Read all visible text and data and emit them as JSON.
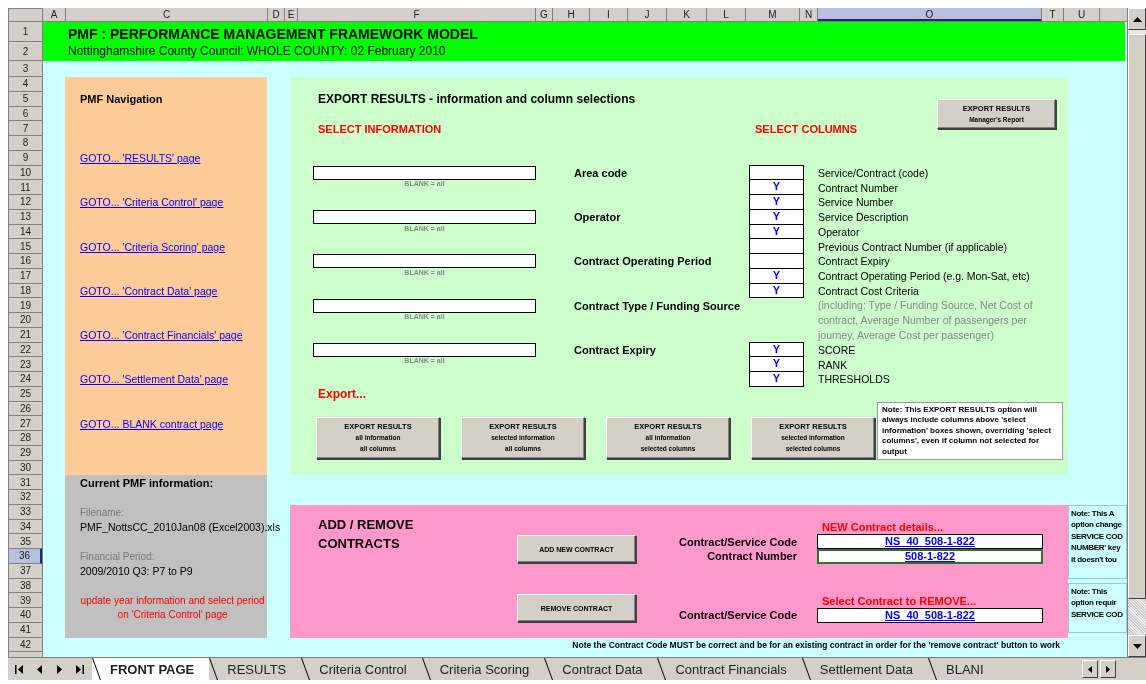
{
  "sheet": {
    "column_headers": [
      {
        "label": "A",
        "selected": false
      },
      {
        "label": "C",
        "selected": false
      },
      {
        "label": "D",
        "selected": false
      },
      {
        "label": "E",
        "selected": false
      },
      {
        "label": "F",
        "selected": false
      },
      {
        "label": "G",
        "selected": false
      },
      {
        "label": "H",
        "selected": false
      },
      {
        "label": "I",
        "selected": false
      },
      {
        "label": "J",
        "selected": false
      },
      {
        "label": "K",
        "selected": false
      },
      {
        "label": "L",
        "selected": false
      },
      {
        "label": "M",
        "selected": false
      },
      {
        "label": "N",
        "selected": false
      },
      {
        "label": "O",
        "selected": true
      },
      {
        "label": "T",
        "selected": false
      },
      {
        "label": "U",
        "selected": false
      }
    ],
    "row_headers": [
      {
        "label": "1",
        "selected": false
      },
      {
        "label": "2",
        "selected": false
      },
      {
        "label": "3",
        "selected": false
      },
      {
        "label": "4",
        "selected": false
      },
      {
        "label": "5",
        "selected": false
      },
      {
        "label": "6",
        "selected": false
      },
      {
        "label": "7",
        "selected": false
      },
      {
        "label": "8",
        "selected": false
      },
      {
        "label": "9",
        "selected": false
      },
      {
        "label": "10",
        "selected": false
      },
      {
        "label": "11",
        "selected": false
      },
      {
        "label": "12",
        "selected": false
      },
      {
        "label": "13",
        "selected": false
      },
      {
        "label": "14",
        "selected": false
      },
      {
        "label": "15",
        "selected": false
      },
      {
        "label": "16",
        "selected": false
      },
      {
        "label": "17",
        "selected": false
      },
      {
        "label": "18",
        "selected": false
      },
      {
        "label": "19",
        "selected": false
      },
      {
        "label": "20",
        "selected": false
      },
      {
        "label": "21",
        "selected": false
      },
      {
        "label": "22",
        "selected": false
      },
      {
        "label": "23",
        "selected": false
      },
      {
        "label": "24",
        "selected": false
      },
      {
        "label": "25",
        "selected": false
      },
      {
        "label": "26",
        "selected": false
      },
      {
        "label": "27",
        "selected": false
      },
      {
        "label": "28",
        "selected": false
      },
      {
        "label": "29",
        "selected": false
      },
      {
        "label": "30",
        "selected": false
      },
      {
        "label": "31",
        "selected": false
      },
      {
        "label": "32",
        "selected": false
      },
      {
        "label": "33",
        "selected": false
      },
      {
        "label": "34",
        "selected": false
      },
      {
        "label": "35",
        "selected": false
      },
      {
        "label": "36",
        "selected": true
      },
      {
        "label": "37",
        "selected": false
      },
      {
        "label": "38",
        "selected": false
      },
      {
        "label": "39",
        "selected": false
      },
      {
        "label": "40",
        "selected": false
      },
      {
        "label": "41",
        "selected": false
      },
      {
        "label": "42",
        "selected": false
      }
    ]
  },
  "banner": {
    "title": "PMF : PERFORMANCE MANAGEMENT FRAMEWORK MODEL",
    "subtitle": "Nottinghamshire County Council: WHOLE COUNTY: 02 February 2010"
  },
  "navigation": {
    "title": "PMF Navigation",
    "links": [
      "GOTO... 'RESULTS' page",
      "GOTO... 'Criteria Control' page",
      "GOTO... 'Criteria Scoring' page",
      "GOTO... 'Contract Data' page",
      "GOTO... 'Contract Financials' page",
      "GOTO... 'Settlement Data' page",
      "GOTO... BLANK contract page"
    ]
  },
  "export_results": {
    "title": "EXPORT RESULTS - information and column selections",
    "manager_button": [
      "EXPORT RESULTS",
      "Manager's Report"
    ],
    "select_information_heading": "SELECT INFORMATION",
    "select_columns_heading": "SELECT COLUMNS",
    "filters": [
      {
        "label": "Area code",
        "hint": "BLANK = all"
      },
      {
        "label": "Operator",
        "hint": "BLANK = all"
      },
      {
        "label": "Contract Operating Period",
        "hint": "BLANK = all"
      },
      {
        "label": "Contract Type / Funding Source",
        "hint": "BLANK = all"
      },
      {
        "label": "Contract Expiry",
        "hint": "BLANK = all"
      }
    ],
    "columns": [
      {
        "kind": "column",
        "label": "Service/Contract (code)"
      },
      {
        "kind": "column",
        "label": "Contract Number",
        "value": "Y"
      },
      {
        "kind": "column",
        "label": "Service Number",
        "value": "Y"
      },
      {
        "kind": "column",
        "label": "Service Description",
        "value": "Y"
      },
      {
        "kind": "column",
        "label": "Operator",
        "value": "Y"
      },
      {
        "kind": "column",
        "label": "Previous Contract Number (if applicable)"
      },
      {
        "kind": "column",
        "label": "Contract Expiry"
      },
      {
        "kind": "column",
        "label": "Contract Operating Period (e.g. Mon-Sat, etc)",
        "value": "Y"
      },
      {
        "kind": "column",
        "label": "Contract Cost Criteria",
        "value": "Y"
      },
      {
        "kind": "note",
        "label": "(including: Type / Funding Source, Net Cost of contract, Average Number of passengers per journey, Average Cost per passenger)"
      },
      {
        "kind": "column",
        "label": "SCORE",
        "value": "Y"
      },
      {
        "kind": "column",
        "label": "RANK",
        "value": "Y"
      },
      {
        "kind": "column",
        "label": "THRESHOLDS",
        "value": "Y"
      }
    ],
    "export_heading": "Export...",
    "buttons": [
      [
        "EXPORT RESULTS",
        "all information",
        "all columns"
      ],
      [
        "EXPORT RESULTS",
        "selected information",
        "all columns"
      ],
      [
        "EXPORT RESULTS",
        "all information",
        "selected columns"
      ],
      [
        "EXPORT RESULTS",
        "selected information",
        "selected columns"
      ]
    ],
    "note": "Note: This EXPORT RESULTS option will always include columns above 'select information' boxes shown, overriding 'select columns', even if column not selected for output"
  },
  "pmf_info": {
    "title": "Current PMF information:",
    "filename_label": "Filename:",
    "filename": "PMF_NottsCC_2010Jan08 (Excel2003).xls",
    "period_label": "Financial Period:",
    "period": "2009/2010 Q3: P7 to P9",
    "instruction": "update year information and select period on 'Criteria Control' page"
  },
  "contracts": {
    "title": "ADD / REMOVE CONTRACTS",
    "add_button": "ADD NEW CONTRACT",
    "remove_button": "REMOVE CONTRACT",
    "new_heading": "NEW Contract details...",
    "new_fields": [
      {
        "label": "Contract/Service Code",
        "value": "NS_40_508-1-822",
        "selected": false
      },
      {
        "label": "Contract Number",
        "value": "508-1-822",
        "selected": true
      }
    ],
    "remove_heading": "Select Contract to REMOVE...",
    "remove_fields": [
      {
        "label": "Contract/Service Code",
        "value": "NS_40_508-1-822",
        "selected": false
      }
    ]
  },
  "side_notes": [
    {
      "lines": [
        "Note: This A",
        "option change",
        "SERVICE COD",
        "NUMBER' key",
        "it doesn't tou"
      ]
    },
    {
      "lines": [
        "Note: This",
        "option requir",
        "SERVICE COD"
      ]
    }
  ],
  "footer_note": "Note the Contract Code MUST be correct and be for an existing contract in order for the 'remove contract' button to work",
  "tab_bar": {
    "tabs": [
      {
        "label": "FRONT PAGE",
        "selected": true
      },
      {
        "label": "RESULTS",
        "selected": false
      },
      {
        "label": "Criteria Control",
        "selected": false
      },
      {
        "label": "Criteria Scoring",
        "selected": false
      },
      {
        "label": "Contract Data",
        "selected": false
      },
      {
        "label": "Contract Financials",
        "selected": false
      },
      {
        "label": "Settlement Data",
        "selected": false
      },
      {
        "label": "BLANI",
        "selected": false
      }
    ]
  }
}
